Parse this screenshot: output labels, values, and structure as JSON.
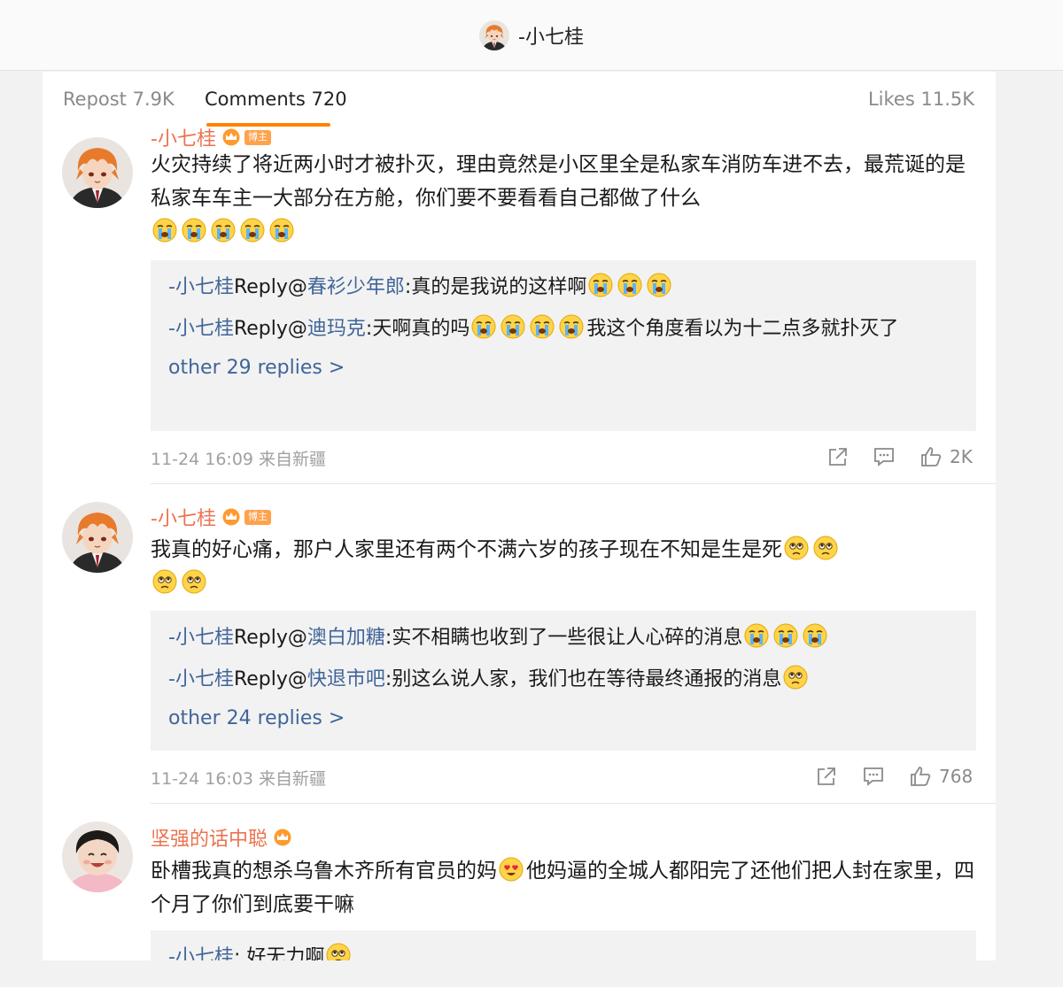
{
  "header": {
    "title": "-小七桂",
    "avatar_icon": "anime-avatar-icon"
  },
  "tabs": {
    "repost": "Repost 7.9K",
    "comments": "Comments 720",
    "likes": "Likes 11.5K",
    "active_color": "#ff8200"
  },
  "colors": {
    "username": "#eb7350",
    "link": "#406599",
    "badge": "#ffa24c"
  },
  "comments": [
    {
      "user": "-小七桂",
      "badge": "博主",
      "text": "火灾持续了将近两小时才被扑灭，理由竟然是小区里全是私家车消防车进不去，最荒诞的是私家车车主一大部分在方舱，你们要不要看看自己都做了什么",
      "replies": [
        {
          "user": "-小七桂",
          "word": "Reply@",
          "target": "春衫少年郎",
          "text": ":真的是我说的这样啊"
        },
        {
          "user": "-小七桂",
          "word": "Reply@",
          "target": "迪玛克",
          "text": ":天啊真的吗",
          "text2": "我这个角度看以为十二点多就扑灭了"
        }
      ],
      "more": "other 29 replies >",
      "time": "11-24 16:09 来自新疆",
      "likes": "2K"
    },
    {
      "user": "-小七桂",
      "badge": "博主",
      "text": "我真的好心痛，那户人家里还有两个不满六岁的孩子现在不知是生是死",
      "replies": [
        {
          "user": "-小七桂",
          "word": "Reply@",
          "target": "澳白加糖",
          "text": ":实不相瞒也收到了一些很让人心碎的消息"
        },
        {
          "user": "-小七桂",
          "word": "Reply@",
          "target": "快退市吧",
          "text": ":别这么说人家，我们也在等待最终通报的消息"
        }
      ],
      "more": "other 24 replies >",
      "time": "11-24 16:03 来自新疆",
      "likes": "768"
    },
    {
      "user": "坚强的话中聪",
      "text": "卧槽我真的想杀乌鲁木齐所有官员的妈",
      "text2": "他妈逼的全城人都阳完了还他们把人封在家里，四个月了你们到底要干嘛",
      "replies": [
        {
          "user": "-小七桂",
          "text": ": 好无力啊"
        }
      ]
    }
  ]
}
